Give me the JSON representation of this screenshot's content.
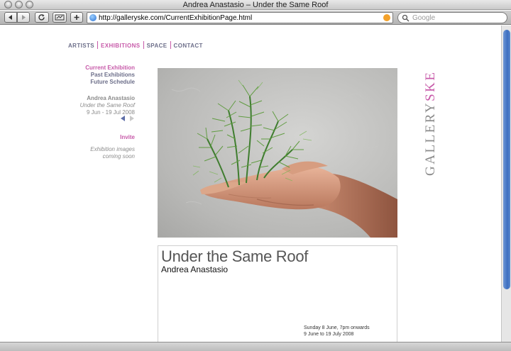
{
  "window": {
    "title": "Andrea Anastasio – Under the Same Roof"
  },
  "toolbar": {
    "url": "http://galleryske.com/CurrentExhibitionPage.html",
    "search_placeholder": "Google",
    "back_icon": "back-arrow-icon",
    "forward_icon": "forward-arrow-icon",
    "reload_icon": "reload-icon",
    "add_icon": "plus-icon"
  },
  "nav": {
    "items": [
      {
        "label": "ARTISTS",
        "active": false
      },
      {
        "label": "EXHIBITIONS",
        "active": true
      },
      {
        "label": "SPACE",
        "active": false
      },
      {
        "label": "CONTACT",
        "active": false
      }
    ]
  },
  "sidebar": {
    "current": "Current Exhibition",
    "past": "Past Exhibitions",
    "future": "Future Schedule",
    "artist": "Andrea Anastasio",
    "show_title": "Under the Same Roof",
    "dates": "9 Jun - 19 Jul 2008",
    "invite": "Invite",
    "images_line1": "Exhibition images",
    "images_line2": "coming soon"
  },
  "logo": {
    "text": "GALLERYSKE",
    "part1": "GALLERY",
    "part2": "SKE"
  },
  "caption": {
    "title": "Under the Same Roof",
    "artist": "Andrea Anastasio",
    "opening": "Sunday 8 June, 7pm onwards",
    "run": "9 June to 19 July 2008"
  },
  "colors": {
    "accent": "#c75aa9",
    "link": "#6d6f8a",
    "scroll": "#3d6fc0"
  }
}
